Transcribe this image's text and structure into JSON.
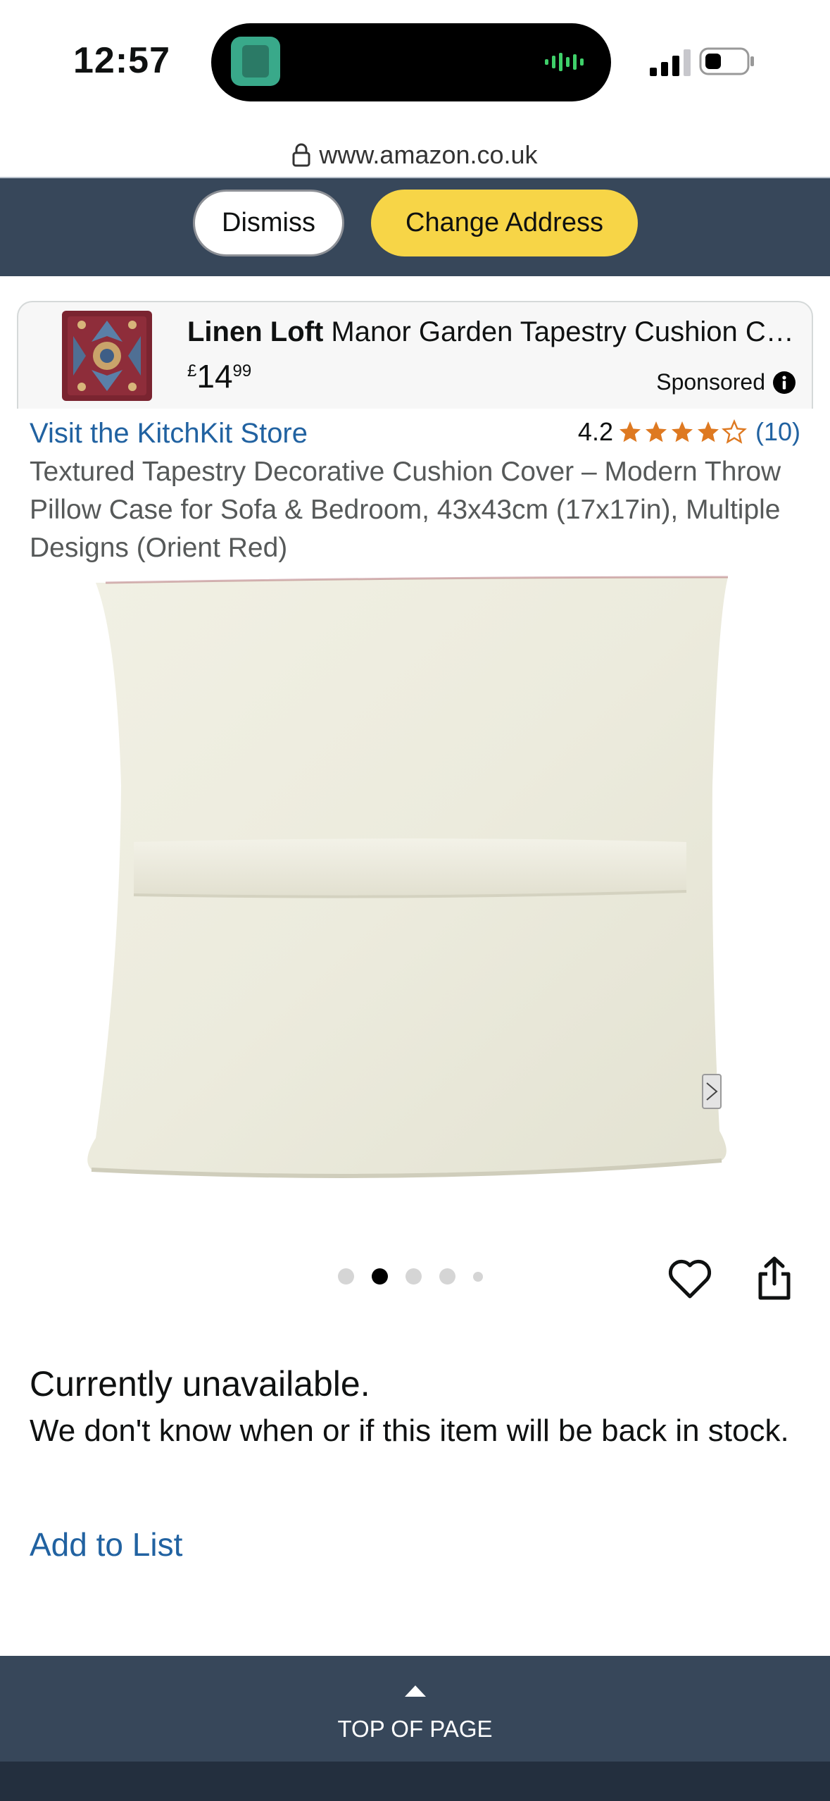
{
  "status_bar": {
    "time": "12:57"
  },
  "browser": {
    "url": "www.amazon.co.uk"
  },
  "address_bar": {
    "dismiss_label": "Dismiss",
    "change_label": "Change Address"
  },
  "sponsored": {
    "brand": "Linen Loft",
    "title": "Manor Garden Tapestry Cushion Cover",
    "currency": "£",
    "price_whole": "14",
    "price_fraction": "99",
    "label": "Sponsored"
  },
  "product": {
    "store_link": "Visit the KitchKit Store",
    "rating": "4.2",
    "rating_stars": 4.2,
    "rating_count": "(10)",
    "title": "Textured Tapestry Decorative Cushion Cover – Modern Throw Pillow Case for Sofa & Bedroom, 43x43cm (17x17in), Multiple Designs (Orient Red)",
    "image_count": 5,
    "active_image": 2
  },
  "availability": {
    "status": "Currently unavailable.",
    "message": "We don't know when or if this item will be back in stock.",
    "add_to_list": "Add to List"
  },
  "footer": {
    "top_of_page": "TOP OF PAGE"
  },
  "colors": {
    "nav_dark": "#37475a",
    "footer_dark": "#232f3e",
    "accent_yellow": "#f7d547",
    "link_blue": "#2162a1",
    "star_orange": "#de7921"
  }
}
